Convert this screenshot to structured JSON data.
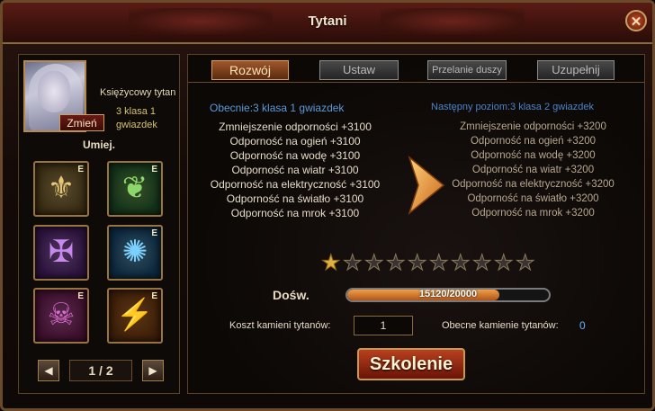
{
  "window": {
    "title": "Tytani",
    "close_symbol": "✕"
  },
  "titan": {
    "name": "Księżycowy tytan",
    "class_line1": "3 klasa 1",
    "class_line2": "gwiazdek",
    "change_label": "Zmień"
  },
  "skills": {
    "header": "Umiej.",
    "items": [
      {
        "icon": "rune-gold-icon",
        "glyph": "⚜",
        "badge": "E",
        "bg": "#3a2e14",
        "color": "#e8c878"
      },
      {
        "icon": "winged-emblem-icon",
        "glyph": "❦",
        "badge": "E",
        "bg": "#14341a",
        "color": "#8cd86a"
      },
      {
        "icon": "demon-sigil-icon",
        "glyph": "✠",
        "badge": "",
        "bg": "#2e1440",
        "color": "#c888f0"
      },
      {
        "icon": "spiked-sun-icon",
        "glyph": "✺",
        "badge": "E",
        "bg": "#0e2a40",
        "color": "#7ad0ff"
      },
      {
        "icon": "skull-sigil-icon",
        "glyph": "☠",
        "badge": "E",
        "bg": "#40102e",
        "color": "#e06ad0"
      },
      {
        "icon": "flame-rune-icon",
        "glyph": "⚡",
        "badge": "E",
        "bg": "#40200a",
        "color": "#f08a2a"
      }
    ]
  },
  "pager": {
    "prev": "◀",
    "next": "▶",
    "label": "1 / 2"
  },
  "tabs": [
    {
      "label": "Rozwój",
      "active": true
    },
    {
      "label": "Ustaw",
      "active": false
    },
    {
      "label": "Przelanie duszy",
      "active": false
    },
    {
      "label": "Uzupełnij",
      "active": false
    }
  ],
  "current": {
    "header": "Obecnie:3 klasa 1 gwiazdek",
    "lines": [
      "Zmniejszenie odporności +3100",
      "Odporność na ogień +3100",
      "Odporność na wodę +3100",
      "Odporność na wiatr +3100",
      "Odporność na elektryczność +3100",
      "Odporność na światło +3100",
      "Odporność na mrok +3100"
    ]
  },
  "next": {
    "header": "Następny poziom:3 klasa 2 gwiazdek",
    "lines": [
      "Zmniejszenie odporności +3200",
      "Odporność na ogień +3200",
      "Odporność na wodę +3200",
      "Odporność na wiatr +3200",
      "Odporność na elektryczność +3200",
      "Odporność na światło +3200",
      "Odporność na mrok +3200"
    ]
  },
  "stars": {
    "total": 10,
    "filled": 1
  },
  "experience": {
    "label": "Dośw.",
    "current": 15120,
    "max": 20000,
    "text": "15120/20000"
  },
  "cost": {
    "label": "Koszt kamieni tytanów:",
    "value": "1"
  },
  "owned": {
    "label": "Obecne kamienie tytanów:",
    "value": "0"
  },
  "train_button": "Szkolenie",
  "colors": {
    "accent": "#d8a050",
    "current_header": "#5a9ad8",
    "next_header": "#4a84c8",
    "owned_value": "#6ab2ff"
  }
}
